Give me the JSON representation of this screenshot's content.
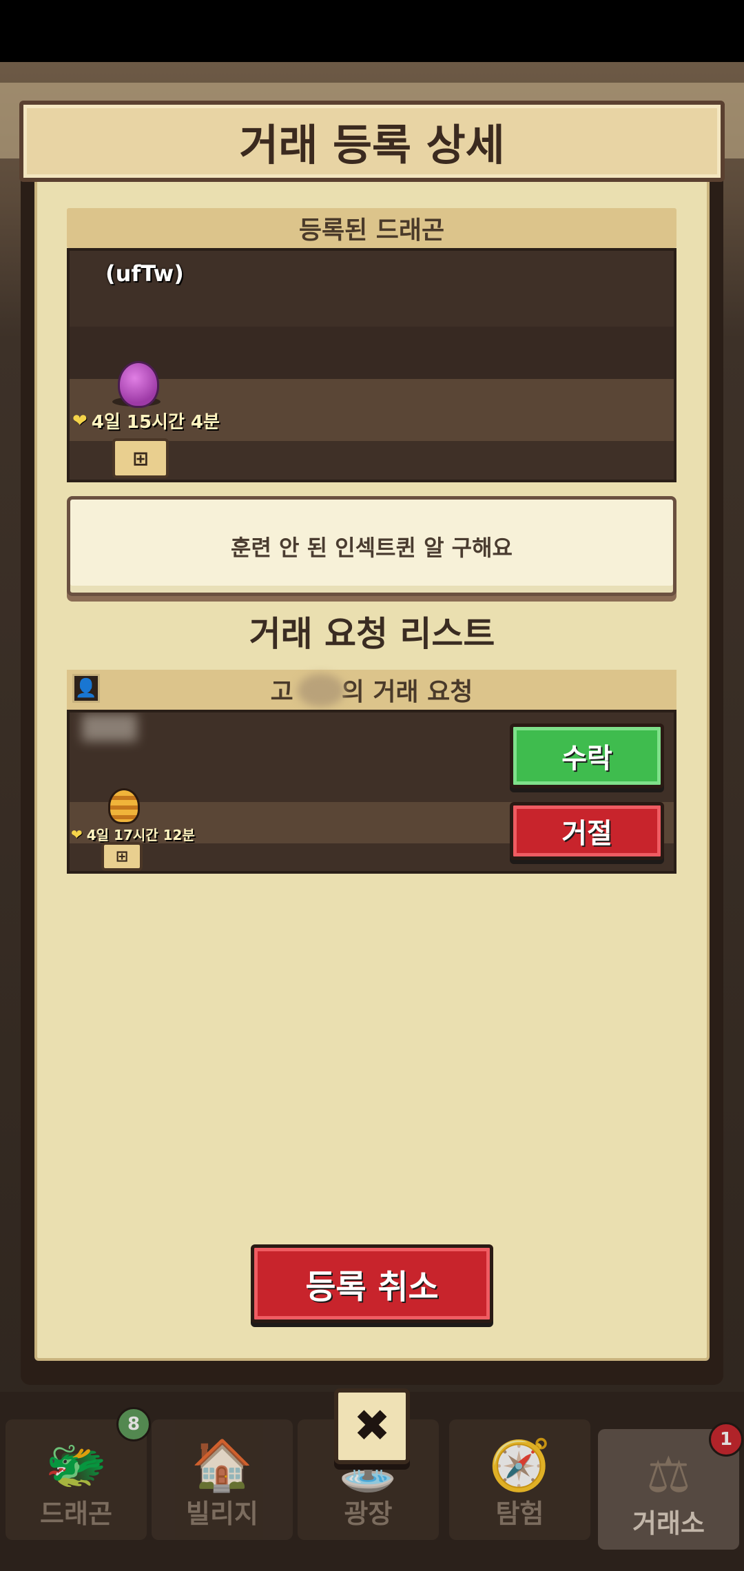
{
  "modal": {
    "title": "거래 등록 상세",
    "registered_section_title": "등록된 드래곤",
    "registered_dragon": {
      "name": "(ufTw)",
      "time_left": "4일 15시간 4분",
      "egg_color": "#b24fbb"
    },
    "note": "훈련 안 된 인섹트퀸 알 구해요",
    "request_list_title": "거래 요청 리스트",
    "request": {
      "header_prefix": "고",
      "header_suffix": "의 거래 요청",
      "time_left": "4일 17시간 12분",
      "accept_label": "수락",
      "reject_label": "거절"
    },
    "cancel_label": "등록 취소",
    "close_symbol": "✖"
  },
  "nav": {
    "items": [
      {
        "label": "드래곤",
        "badge": "8",
        "icon": "dragon-icon"
      },
      {
        "label": "빌리지",
        "icon": "village-icon"
      },
      {
        "label": "광장",
        "icon": "plaza-icon"
      },
      {
        "label": "탐험",
        "icon": "compass-icon"
      },
      {
        "label": "거래소",
        "badge": "1",
        "icon": "scales-icon"
      }
    ]
  },
  "colors": {
    "accent_green": "#3fbc4e",
    "accent_red": "#c8242c",
    "paper": "#eadfb0"
  }
}
